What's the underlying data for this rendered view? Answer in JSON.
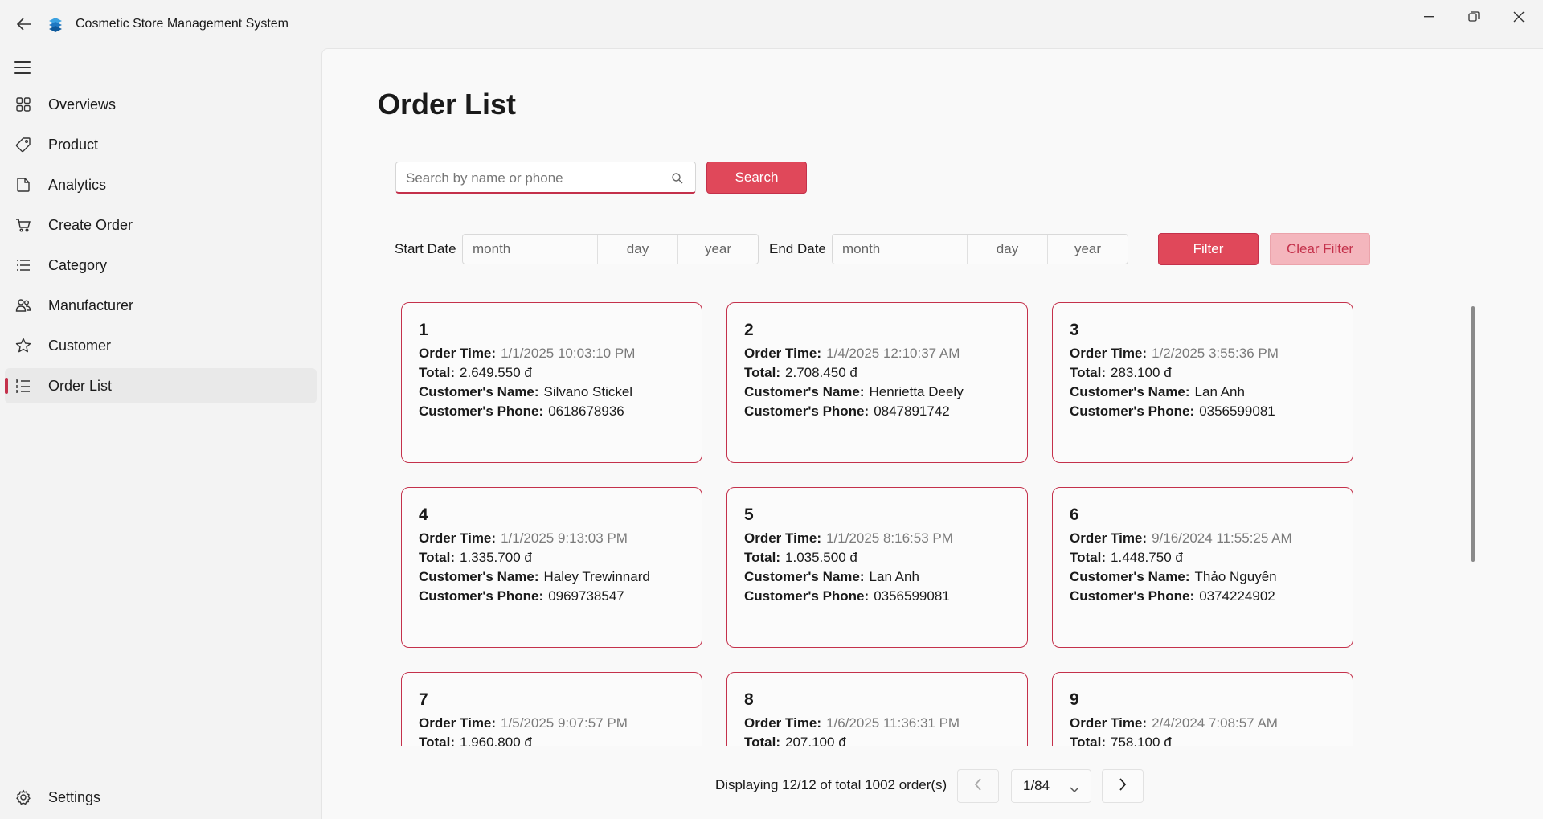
{
  "app": {
    "title": "Cosmetic Store Management System",
    "accent_color": "#c4314b"
  },
  "sidebar": {
    "items": [
      {
        "label": "Overviews",
        "icon": "grid-icon"
      },
      {
        "label": "Product",
        "icon": "tag-icon"
      },
      {
        "label": "Analytics",
        "icon": "document-icon"
      },
      {
        "label": "Create Order",
        "icon": "cart-icon"
      },
      {
        "label": "Category",
        "icon": "list-icon"
      },
      {
        "label": "Manufacturer",
        "icon": "people-icon"
      },
      {
        "label": "Customer",
        "icon": "star-icon"
      },
      {
        "label": "Order List",
        "icon": "ordered-list-icon",
        "active": true
      }
    ],
    "settings_label": "Settings"
  },
  "main": {
    "title": "Order List",
    "search": {
      "placeholder": "Search by name or phone",
      "value": "",
      "button_label": "Search"
    },
    "filter": {
      "start_label": "Start Date",
      "end_label": "End Date",
      "start": {
        "month": "month",
        "day": "day",
        "year": "year"
      },
      "end": {
        "month": "month",
        "day": "day",
        "year": "year"
      },
      "filter_label": "Filter",
      "clear_label": "Clear Filter"
    },
    "field_labels": {
      "order_time": "Order Time:",
      "total": "Total:",
      "customer_name": "Customer's Name:",
      "customer_phone": "Customer's Phone:"
    },
    "orders": [
      {
        "id": "1",
        "time": "1/1/2025 10:03:10 PM",
        "total": "2.649.550 đ",
        "name": "Silvano Stickel",
        "phone": "0618678936"
      },
      {
        "id": "2",
        "time": "1/4/2025 12:10:37 AM",
        "total": "2.708.450 đ",
        "name": "Henrietta Deely",
        "phone": "0847891742"
      },
      {
        "id": "3",
        "time": "1/2/2025 3:55:36 PM",
        "total": "283.100 đ",
        "name": "Lan Anh",
        "phone": "0356599081"
      },
      {
        "id": "4",
        "time": "1/1/2025 9:13:03 PM",
        "total": "1.335.700 đ",
        "name": "Haley Trewinnard",
        "phone": "0969738547"
      },
      {
        "id": "5",
        "time": "1/1/2025 8:16:53 PM",
        "total": "1.035.500 đ",
        "name": "Lan Anh",
        "phone": "0356599081"
      },
      {
        "id": "6",
        "time": "9/16/2024 11:55:25 AM",
        "total": "1.448.750 đ",
        "name": "Thảo Nguyên",
        "phone": "0374224902"
      },
      {
        "id": "7",
        "time": "1/5/2025 9:07:57 PM",
        "total": "1.960.800 đ",
        "name": "",
        "phone": ""
      },
      {
        "id": "8",
        "time": "1/6/2025 11:36:31 PM",
        "total": "207.100 đ",
        "name": "",
        "phone": ""
      },
      {
        "id": "9",
        "time": "2/4/2024 7:08:57 AM",
        "total": "758.100 đ",
        "name": "",
        "phone": ""
      }
    ],
    "footer": {
      "displaying_text": "Displaying 12/12 of total 1002 order(s)",
      "page_selected": "1/84"
    }
  }
}
